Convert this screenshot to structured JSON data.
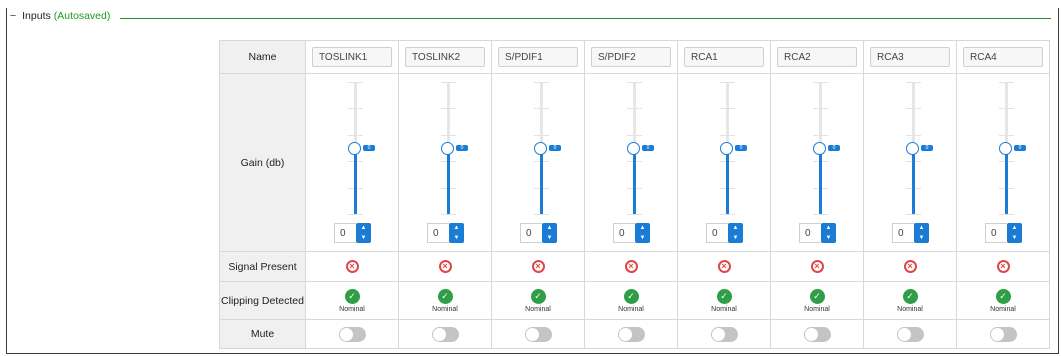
{
  "section": {
    "toggle": "−",
    "title": "Inputs",
    "status": "(Autosaved)",
    "status_color": "#1e9b1e"
  },
  "rows": {
    "name": "Name",
    "gain": "Gain (db)",
    "signal": "Signal Present",
    "clipping": "Clipping Detected",
    "mute": "Mute"
  },
  "channels": [
    {
      "name": "TOSLINK1",
      "gain": "0",
      "gain_marker": "0",
      "gain_level": 0.5,
      "signal_icon": "x-circle-icon",
      "clipping_icon": "check-circle-icon",
      "clipping_label": "Nominal",
      "mute": false
    },
    {
      "name": "TOSLINK2",
      "gain": "0",
      "gain_marker": "0",
      "gain_level": 0.5,
      "signal_icon": "x-circle-icon",
      "clipping_icon": "check-circle-icon",
      "clipping_label": "Nominal",
      "mute": false
    },
    {
      "name": "S/PDIF1",
      "gain": "0",
      "gain_marker": "0",
      "gain_level": 0.5,
      "signal_icon": "x-circle-icon",
      "clipping_icon": "check-circle-icon",
      "clipping_label": "Nominal",
      "mute": false
    },
    {
      "name": "S/PDIF2",
      "gain": "0",
      "gain_marker": "0",
      "gain_level": 0.5,
      "signal_icon": "x-circle-icon",
      "clipping_icon": "check-circle-icon",
      "clipping_label": "Nominal",
      "mute": false
    },
    {
      "name": "RCA1",
      "gain": "0",
      "gain_marker": "0",
      "gain_level": 0.5,
      "signal_icon": "x-circle-icon",
      "clipping_icon": "check-circle-icon",
      "clipping_label": "Nominal",
      "mute": false
    },
    {
      "name": "RCA2",
      "gain": "0",
      "gain_marker": "0",
      "gain_level": 0.5,
      "signal_icon": "x-circle-icon",
      "clipping_icon": "check-circle-icon",
      "clipping_label": "Nominal",
      "mute": false
    },
    {
      "name": "RCA3",
      "gain": "0",
      "gain_marker": "0",
      "gain_level": 0.5,
      "signal_icon": "x-circle-icon",
      "clipping_icon": "check-circle-icon",
      "clipping_label": "Nominal",
      "mute": false
    },
    {
      "name": "RCA4",
      "gain": "0",
      "gain_marker": "0",
      "gain_level": 0.5,
      "signal_icon": "x-circle-icon",
      "clipping_icon": "check-circle-icon",
      "clipping_label": "Nominal",
      "mute": false
    }
  ],
  "colors": {
    "accent": "#1a7cd4",
    "error": "#e04747",
    "success": "#2e9e47"
  }
}
